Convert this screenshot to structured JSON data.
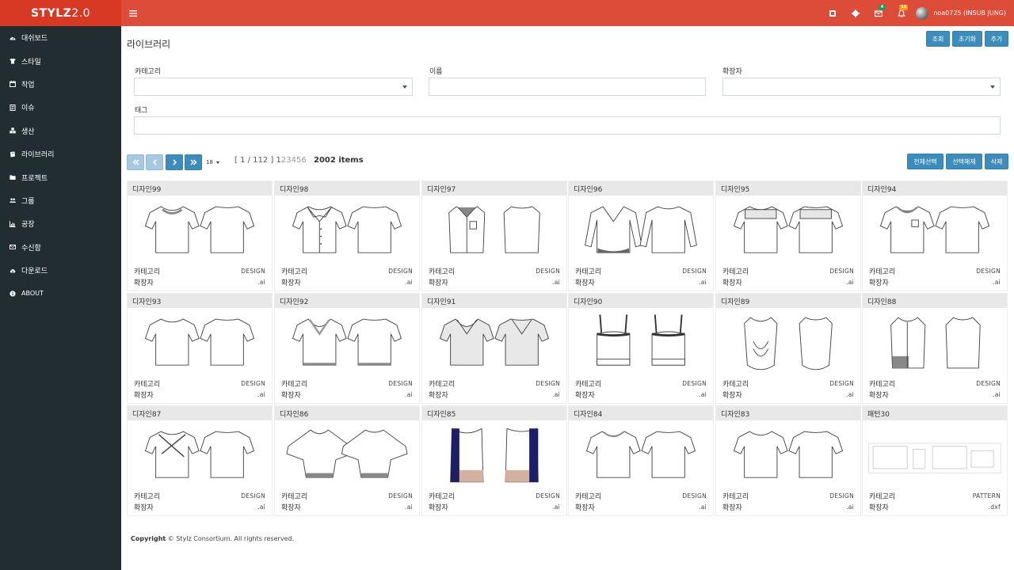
{
  "app": {
    "brand": "STYLZ",
    "brand_version": "2.0"
  },
  "topbar": {
    "badges": {
      "mail": "4",
      "bell": "10"
    },
    "user_name": "noa0725 (INSUB JUNG)"
  },
  "sidebar": {
    "items": [
      {
        "label": "대쉬보드",
        "icon": "dashboard-icon"
      },
      {
        "label": "스타일",
        "icon": "shirt-icon"
      },
      {
        "label": "작업",
        "icon": "calendar-icon"
      },
      {
        "label": "이슈",
        "icon": "issue-icon"
      },
      {
        "label": "생산",
        "icon": "cubes-icon"
      },
      {
        "label": "라이브러리",
        "icon": "book-icon"
      },
      {
        "label": "프로젝트",
        "icon": "folder-icon"
      },
      {
        "label": "그룹",
        "icon": "users-icon"
      },
      {
        "label": "공장",
        "icon": "chart-icon"
      },
      {
        "label": "수신함",
        "icon": "envelope-icon"
      },
      {
        "label": "다운로드",
        "icon": "cloud-download-icon"
      },
      {
        "label": "ABOUT",
        "icon": "info-icon"
      }
    ]
  },
  "page": {
    "title": "라이브러리",
    "actions": {
      "search": "조회",
      "reset": "초기화",
      "add": "추가"
    },
    "filters": {
      "category_label": "카테고리",
      "name_label": "이름",
      "extension_label": "확장자",
      "tag_label": "태그"
    },
    "pagination": {
      "per_page": "18",
      "position": "[ 1 / 112 ]",
      "pages": [
        "1",
        "2",
        "3",
        "4",
        "5",
        "6"
      ],
      "count": "2002 items"
    },
    "bulk": {
      "select_all": "전체선택",
      "deselect": "선택해제",
      "delete": "삭제"
    }
  },
  "card_labels": {
    "category": "카테고리",
    "extension": "확장자"
  },
  "items": [
    {
      "name": "디자인99",
      "category": "DESIGN",
      "ext": ".ai",
      "thumb": "blouse"
    },
    {
      "name": "디자인98",
      "category": "DESIGN",
      "ext": ".ai",
      "thumb": "collar"
    },
    {
      "name": "디자인97",
      "category": "DESIGN",
      "ext": ".ai",
      "thumb": "sleeveless"
    },
    {
      "name": "디자인96",
      "category": "DESIGN",
      "ext": ".ai",
      "thumb": "longsleeve"
    },
    {
      "name": "디자인95",
      "category": "DESIGN",
      "ext": ".ai",
      "thumb": "yoke"
    },
    {
      "name": "디자인94",
      "category": "DESIGN",
      "ext": ".ai",
      "thumb": "pocket"
    },
    {
      "name": "디자인93",
      "category": "DESIGN",
      "ext": ".ai",
      "thumb": "tee"
    },
    {
      "name": "디자인92",
      "category": "DESIGN",
      "ext": ".ai",
      "thumb": "vneck"
    },
    {
      "name": "디자인91",
      "category": "DESIGN",
      "ext": ".ai",
      "thumb": "greyv"
    },
    {
      "name": "디자인90",
      "category": "DESIGN",
      "ext": ".ai",
      "thumb": "cami"
    },
    {
      "name": "디자인89",
      "category": "DESIGN",
      "ext": ".ai",
      "thumb": "drape"
    },
    {
      "name": "디자인88",
      "category": "DESIGN",
      "ext": ".ai",
      "thumb": "long"
    },
    {
      "name": "디자인87",
      "category": "DESIGN",
      "ext": ".ai",
      "thumb": "wrap"
    },
    {
      "name": "디자인86",
      "category": "DESIGN",
      "ext": ".ai",
      "thumb": "dolman"
    },
    {
      "name": "디자인85",
      "category": "DESIGN",
      "ext": ".ai",
      "thumb": "colorblock"
    },
    {
      "name": "디자인84",
      "category": "DESIGN",
      "ext": ".ai",
      "thumb": "tee2"
    },
    {
      "name": "디자인83",
      "category": "DESIGN",
      "ext": ".ai",
      "thumb": "tee3"
    },
    {
      "name": "패턴30",
      "category": "PATTERN",
      "ext": ".dxf",
      "thumb": "pattern"
    }
  ],
  "footer": {
    "copyright_label": "Copyright",
    "text": "© Stylz Consortium. All rights reserved."
  }
}
